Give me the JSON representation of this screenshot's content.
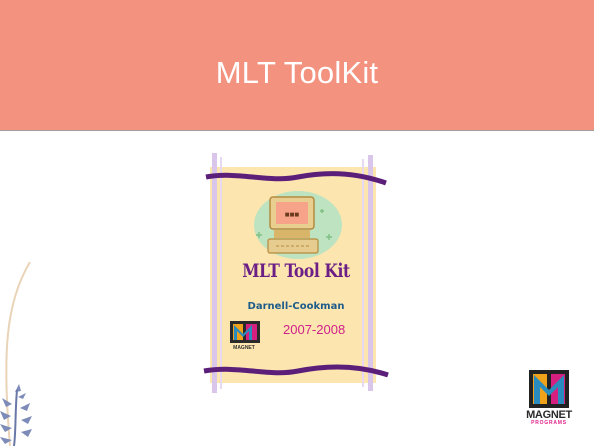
{
  "slide": {
    "title": "MLT ToolKit",
    "colors": {
      "title_band": "#f49280",
      "cover_paper": "#fde5b0",
      "cover_title": "#6b1f86",
      "cover_school": "#1d5c8a",
      "cover_years": "#d0208a"
    }
  },
  "cover": {
    "title": "MLT Tool Kit",
    "school": "Darnell-Cookman",
    "years": "2007-2008",
    "logo_word": "MAGNET"
  },
  "corner_logo": {
    "word": "MAGNET",
    "sub": "PROGRAMS"
  },
  "icons": {
    "cover_art": "computer-clipart-icon",
    "corner_logo": "magnet-programs-logo",
    "decor": "leaf-branch-icon"
  }
}
